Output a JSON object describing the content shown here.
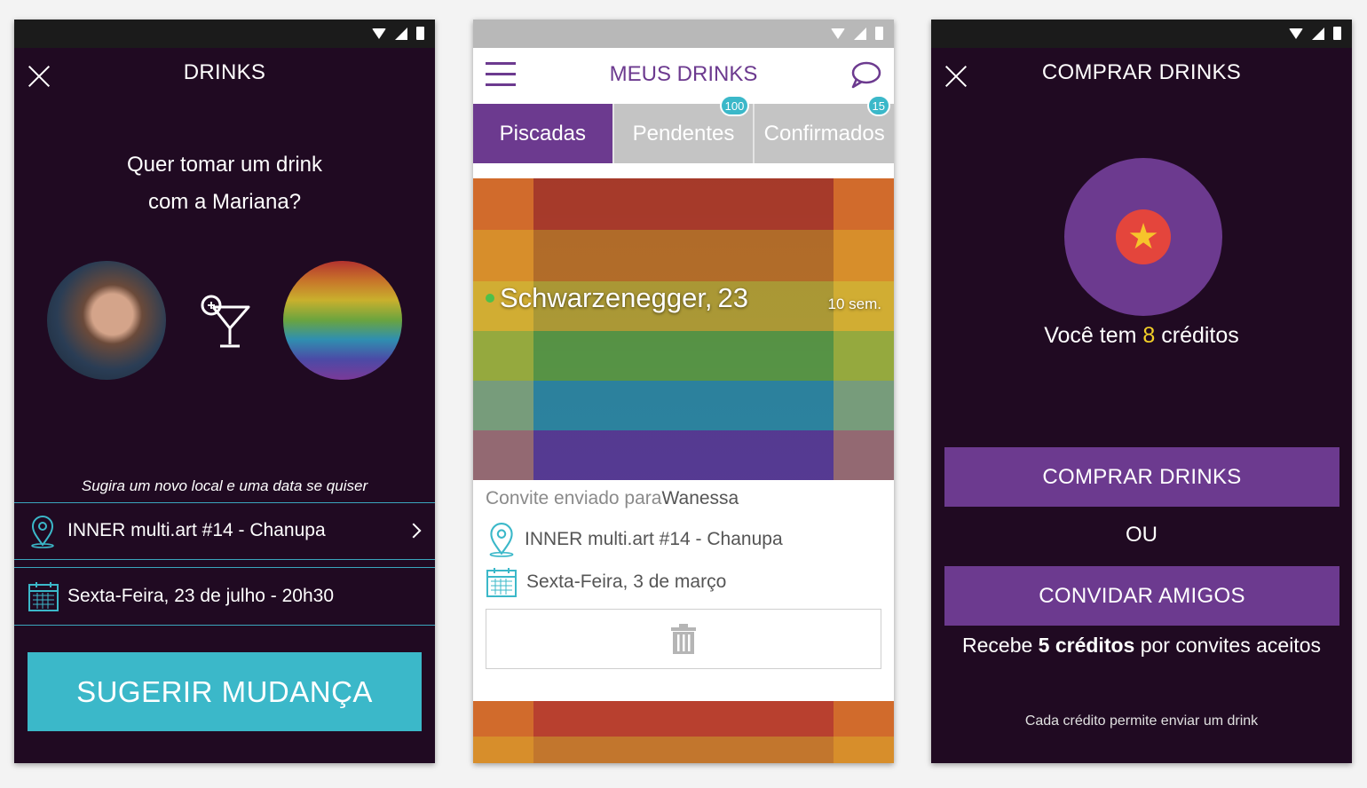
{
  "screen1": {
    "title": "DRINKS",
    "question_line1": "Quer tomar um drink",
    "question_line2_prefix": "com a ",
    "question_name": "Mariana",
    "question_suffix": "?",
    "hint": "Sugira um novo local e uma data se quiser",
    "location": "INNER multi.art #14 - Chanupa",
    "date": "Sexta-Feira, 23 de julho - 20h30",
    "button_label": "SUGERIR MUDANÇA",
    "icons": [
      "close-icon",
      "cocktail-icon",
      "location-pin-icon",
      "calendar-icon",
      "chevron-right-icon"
    ]
  },
  "screen2": {
    "title": "MEUS DRINKS",
    "tabs": [
      {
        "label": "Piscadas",
        "badge": ""
      },
      {
        "label": "Pendentes",
        "badge": "100"
      },
      {
        "label": "Confirmados",
        "badge": "15"
      }
    ],
    "card": {
      "name": "Schwarzenegger,",
      "age": "23",
      "ago": "10 sem.",
      "invite_prefix": "Convite enviado para ",
      "invite_name": "Wanessa",
      "location": "INNER multi.art #14 - Chanupa",
      "date": "Sexta-Feira, 3 de março"
    },
    "icons": [
      "hamburger-menu-icon",
      "chat-bubble-icon",
      "online-dot-icon",
      "location-pin-icon",
      "calendar-icon",
      "trash-icon"
    ]
  },
  "screen3": {
    "title": "COMPRAR DRINKS",
    "credits_prefix": "Você tem ",
    "credits_value": "8",
    "credits_suffix": " créditos",
    "buy_button": "COMPRAR DRINKS",
    "or_label": "OU",
    "invite_button": "CONVIDAR AMIGOS",
    "reward_prefix": "Recebe ",
    "reward_bold": "5 créditos",
    "reward_suffix": " por convites aceitos",
    "footnote": "Cada crédito permite enviar um drink",
    "icons": [
      "close-icon",
      "star-icon"
    ]
  },
  "colors": {
    "dark_bg": "#200a22",
    "purple": "#6c3a8f",
    "teal": "#3bb8c9",
    "credit_yellow": "#f3d028"
  }
}
